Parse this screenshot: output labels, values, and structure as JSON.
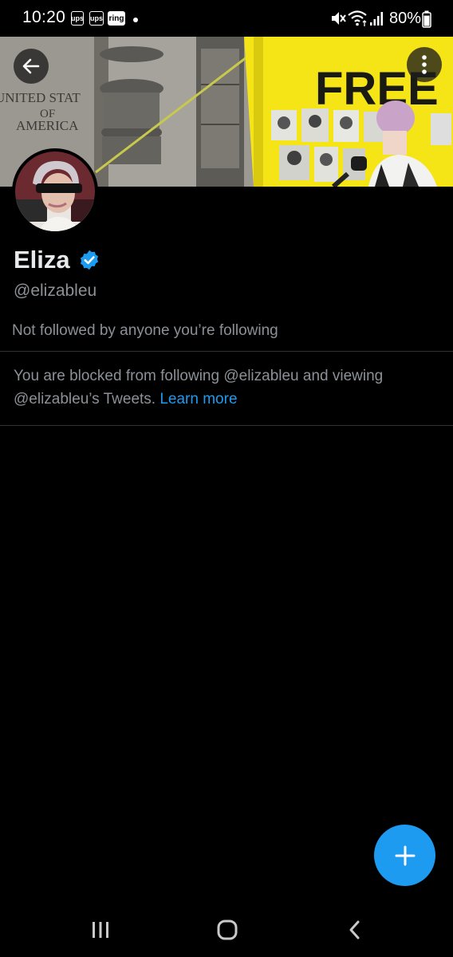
{
  "status_bar": {
    "time": "10:20",
    "notifications": [
      "ups",
      "ups",
      "ring"
    ],
    "battery": "80%",
    "icons": [
      "mute-icon",
      "wifi-icon",
      "signal-icon",
      "battery-icon"
    ]
  },
  "banner": {
    "sign_text": "FREE",
    "building_text_1": "UNITED STAT",
    "building_text_2": "OF",
    "building_text_3": "AMERICA"
  },
  "profile": {
    "display_name": "Eliza",
    "handle": "@elizableu",
    "verified": true,
    "followed_by": "Not followed by anyone you’re following"
  },
  "blocked_notice": {
    "text": "You are blocked from following @elizableu and viewing @elizableu’s Tweets.",
    "link": "Learn more"
  },
  "colors": {
    "background": "#000000",
    "accent": "#1d9bf0",
    "secondary_text": "#8b9197",
    "divider": "#2f3336"
  },
  "fab": {
    "icon": "plus-icon"
  },
  "nav": {
    "icons": [
      "recents-icon",
      "home-icon",
      "back-icon"
    ]
  }
}
